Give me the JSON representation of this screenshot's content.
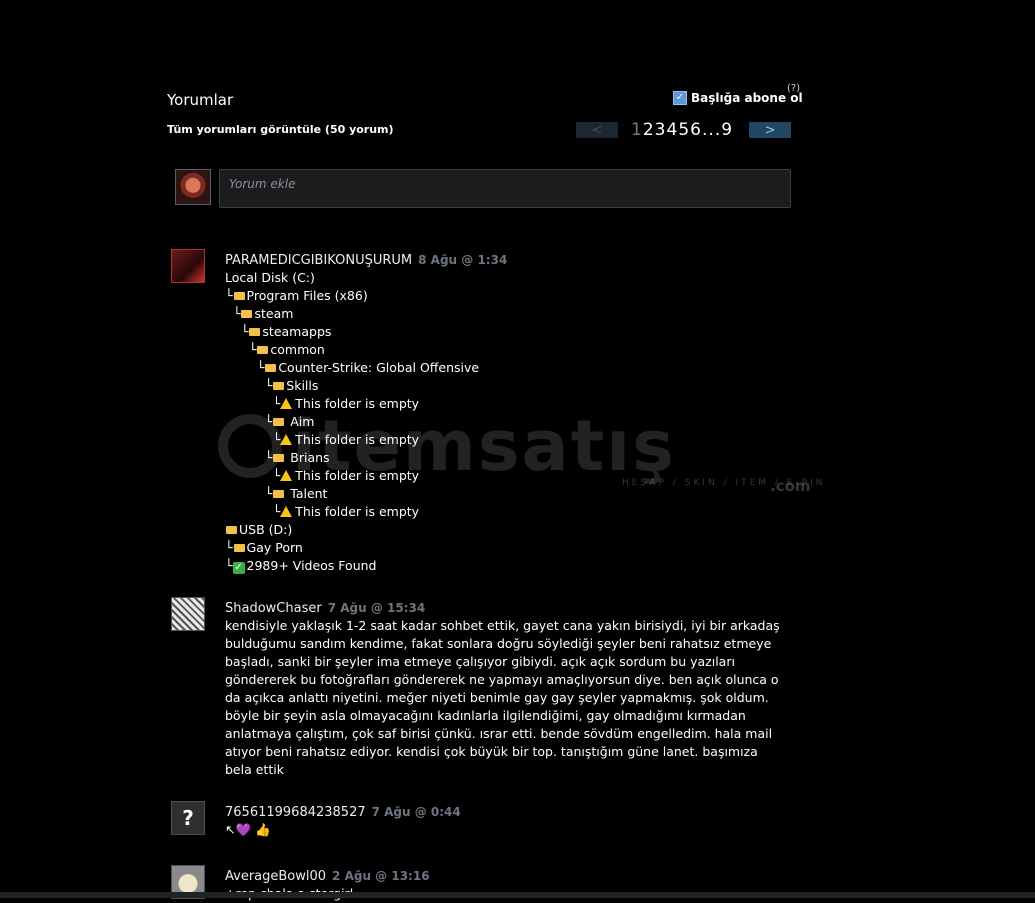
{
  "section": {
    "title": "Yorumlar",
    "view_all": "Tüm yorumları görüntüle (50 yorum)",
    "subscribe_label": "Başlığa abone ol",
    "subscribe_checked": true,
    "help": "(?)"
  },
  "pager": {
    "prev": "<",
    "next": ">",
    "pages": [
      "1",
      "2",
      "3",
      "4",
      "5",
      "6",
      "...",
      "9"
    ],
    "current": "1"
  },
  "add_comment": {
    "placeholder": "Yorum ekle"
  },
  "watermark": {
    "brand": "itemsatış",
    "tagline": "HESAP / SKIN / ITEM / E-PIN",
    "suffix": ".com"
  },
  "comments": [
    {
      "author": "PARAMEDICGIBIKONUŞURUM",
      "time": "8 Ağu @ 1:34",
      "tree": {
        "l0": "Local Disk (C:)",
        "l1": "Program Files (x86)",
        "l2": "steam",
        "l3": "steamapps",
        "l4": "common",
        "l5": "Counter-Strike: Global Offensive",
        "l6": "Skills",
        "l7": "This folder is empty",
        "l8": "Aim",
        "l9": "This folder is empty",
        "l10": "Brians",
        "l11": "This folder is empty",
        "l12": "Talent",
        "l13": "This folder is empty",
        "l14": "USB (D:)",
        "l15": "Gay Porn",
        "l16": "2989+ Videos Found"
      }
    },
    {
      "author": "ShadowChaser",
      "time": "7 Ağu @ 15:34",
      "text": "kendisiyle yaklaşık 1-2 saat kadar sohbet ettik, gayet cana yakın birisiydi, iyi bir arkadaş bulduğumu sandım kendime, fakat sonlara doğru söylediği şeyler beni rahatsız etmeye başladı, sanki bir şeyler ima etmeye çalışıyor gibiydi. açık açık sordum bu yazıları göndererek bu fotoğrafları göndererek ne yapmayı amaçlıyorsun diye. ben açık olunca o da açıkca anlattı niyetini. meğer niyeti benimle gay gay şeyler yapmakmış. şok oldum. böyle bir şeyin asla olmayacağını kadınlarla ilgilendiğimi, gay olmadığımı kırmadan anlatmaya çalıştım, çok saf birisi çünkü. ısrar etti. bende sövdüm engelledim. hala mail atıyor beni rahatsız ediyor. kendisi çok büyük bir top. tanıştığım güne lanet. başımıza bela ettik"
    },
    {
      "author": "76561199684238527",
      "time": "7 Ağu @ 0:44",
      "text_arrow": "↖",
      "text_heart": "💜",
      "text_thumb": "👍",
      "avatar_text": "?"
    },
    {
      "author": "AverageBowl00",
      "time": "2 Ağu @ 13:16",
      "text": "+rep chala a stergirl"
    }
  ]
}
